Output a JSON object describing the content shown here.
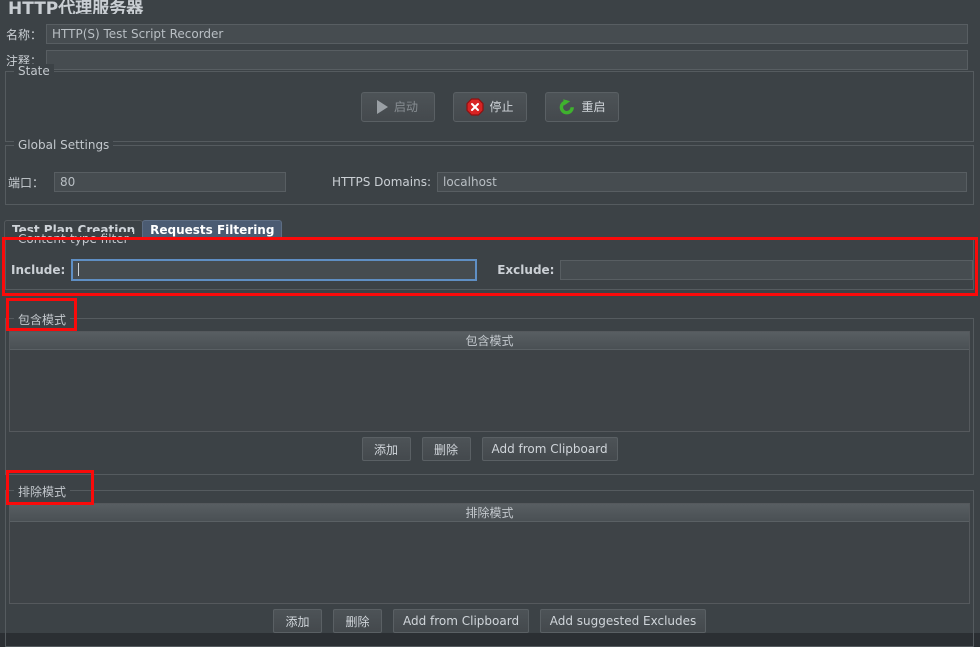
{
  "window": {
    "title": "HTTP代理服务器"
  },
  "form": {
    "name_label": "名称：",
    "name_value": "HTTP(S) Test Script Recorder",
    "comment_label": "注释：",
    "comment_value": ""
  },
  "state": {
    "group_title": "State",
    "start_label": "启动",
    "stop_label": "停止",
    "restart_label": "重启",
    "start_icon": "play-icon",
    "stop_icon": "stop-octagon-icon",
    "restart_icon": "restart-arrow-icon"
  },
  "global_settings": {
    "group_title": "Global Settings",
    "port_label": "端口：",
    "port_value": "80",
    "https_domains_label": "HTTPS Domains:",
    "https_domains_value": "localhost"
  },
  "tabs": [
    {
      "label": "Test Plan Creation",
      "active": false
    },
    {
      "label": "Requests Filtering",
      "active": true
    }
  ],
  "content_type_filter": {
    "group_title": "Content-type filter",
    "include_label": "Include:",
    "include_value": "",
    "exclude_label": "Exclude:",
    "exclude_value": ""
  },
  "include_patterns": {
    "group_title": "包含模式",
    "column_header": "包含模式",
    "rows": [],
    "buttons": [
      {
        "label": "添加",
        "name": "add-button"
      },
      {
        "label": "删除",
        "name": "delete-button"
      },
      {
        "label": "Add from Clipboard",
        "name": "add-from-clipboard-button"
      }
    ]
  },
  "exclude_patterns": {
    "group_title": "排除模式",
    "column_header": "排除模式",
    "rows": [],
    "buttons": [
      {
        "label": "添加",
        "name": "add-button"
      },
      {
        "label": "删除",
        "name": "delete-button"
      },
      {
        "label": "Add from Clipboard",
        "name": "add-from-clipboard-button"
      },
      {
        "label": "Add suggested Excludes",
        "name": "add-suggested-excludes-button"
      }
    ]
  },
  "colors": {
    "panel_bg": "#3c4246",
    "field_bg": "#464c50",
    "accent_tab": "#4b5b72",
    "focus_border": "#5f8fc4",
    "annotation": "#fa0a0a",
    "stop_red": "#d32020",
    "restart_green": "#3fb22e"
  }
}
